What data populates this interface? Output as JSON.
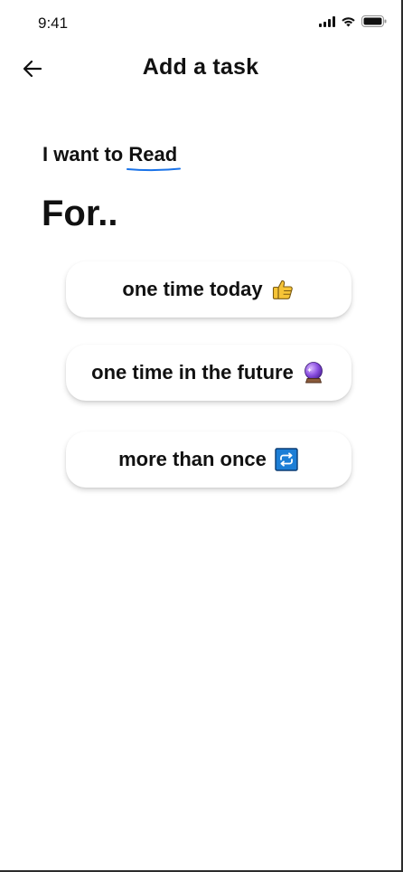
{
  "status_bar": {
    "time": "9:41",
    "icons": [
      "signal-icon",
      "wifi-icon",
      "battery-icon"
    ]
  },
  "header": {
    "title": "Add a task",
    "back_icon": "arrow-left-icon"
  },
  "intro": {
    "prefix": "I want to",
    "task_name": "Read",
    "underline_color": "#1a73e8"
  },
  "heading": "For..",
  "options": [
    {
      "label": "one time today",
      "icon": "thumbs-up-icon"
    },
    {
      "label": "one time in the future",
      "icon": "crystal-ball-icon"
    },
    {
      "label": "more than once",
      "icon": "repeat-icon"
    }
  ]
}
